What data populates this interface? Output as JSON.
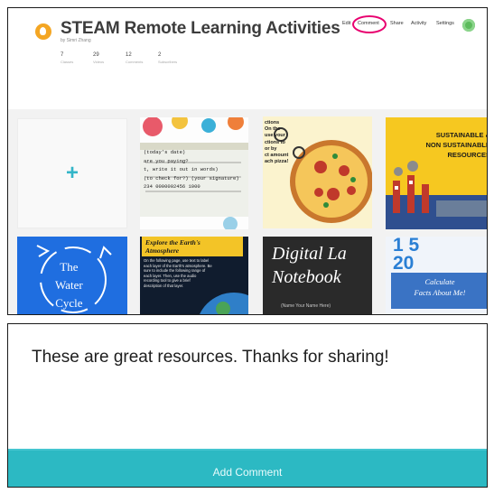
{
  "header": {
    "title": "STEAM Remote Learning Activities",
    "byline": "by Simri Zhang",
    "stats": [
      {
        "value": "7",
        "label": "Classes"
      },
      {
        "value": "29",
        "label": "Videos"
      },
      {
        "value": "12",
        "label": "Comments"
      },
      {
        "value": "2",
        "label": "Subscribers"
      }
    ],
    "nav": {
      "edit": "Edit",
      "comment": "Comment",
      "share": "Share",
      "activity": "Activity",
      "settings": "Settings"
    }
  },
  "grid": {
    "add_symbol": "+",
    "tiles": {
      "check": "(today's date)\nare you paying?\nt, write it out in words)\n(to check for?)    (your signature)\n234   0000002456   1000",
      "pizza": "ctions\nOn the\n use your\nctions to\nor by\nct amount\nach pizza!",
      "sustainable": "SUSTAINABLE &\nNON SUSTAINABLE\nRESOURCES",
      "water": "The\nWater\nCycle",
      "atmosphere_title": "Explore the Earth's\nAtmosphere",
      "atmosphere_body": "On the following page, use text to label\neach layer of the Earth's atmosphere. Be\nsure to include the following range of\neach layer. Then, use the audio\nrecording tool to give a brief\ndescription of that layer.",
      "notebook": "Digital La\nNotebook",
      "notebook_name": "(Name   Your Name Here)",
      "calc_numbers": "1 5\n 20",
      "calc": "Calculate\nFacts About Me!"
    }
  },
  "comment_panel": {
    "text": "These are great resources. Thanks for sharing!",
    "button_label": "Add Comment"
  },
  "colors": {
    "accent_teal": "#2cb9c3",
    "highlight_circle": "#e8006f",
    "logo": "#f4a623"
  },
  "icons": [
    "logo-icon",
    "avatar-icon",
    "plus-icon"
  ]
}
